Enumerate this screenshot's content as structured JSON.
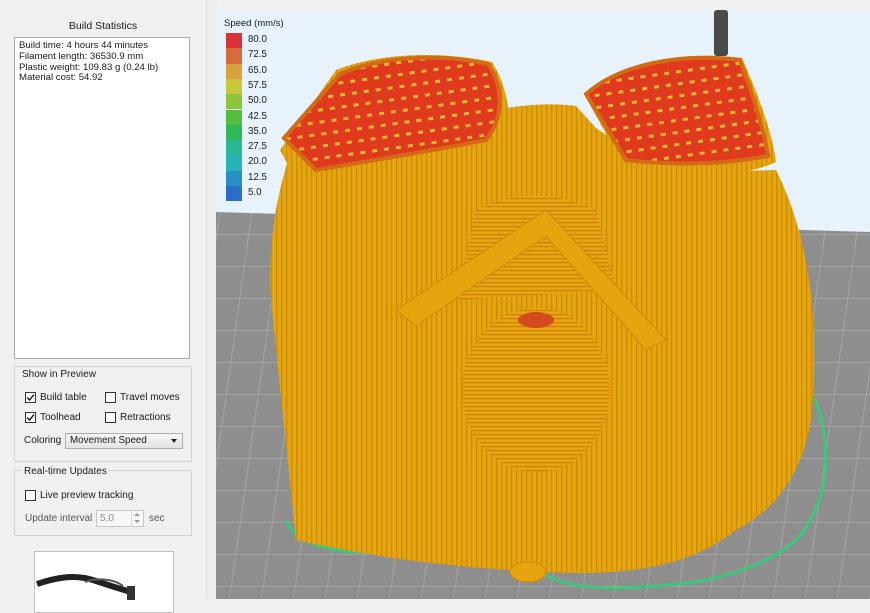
{
  "build_statistics": {
    "title": "Build Statistics",
    "lines": [
      "Build time: 4 hours 44 minutes",
      "Filament length: 36530.9 mm",
      "Plastic weight: 109.83 g (0.24 lb)",
      "Material cost: 54.92"
    ]
  },
  "show_in_preview": {
    "title": "Show in Preview",
    "build_table": {
      "label": "Build table",
      "checked": true
    },
    "travel_moves": {
      "label": "Travel moves",
      "checked": false
    },
    "toolhead": {
      "label": "Toolhead",
      "checked": true
    },
    "retractions": {
      "label": "Retractions",
      "checked": false
    },
    "coloring_label": "Coloring",
    "coloring_value": "Movement Speed"
  },
  "realtime_updates": {
    "title": "Real-time Updates",
    "live_preview": {
      "label": "Live preview tracking",
      "checked": false
    },
    "interval_label": "Update interval",
    "interval_value": "5,0",
    "interval_unit": "sec"
  },
  "legend": {
    "title": "Speed (mm/s)",
    "entries": [
      {
        "value": "80.0",
        "color": "#d8323a"
      },
      {
        "value": "72.5",
        "color": "#d96a3c"
      },
      {
        "value": "65.0",
        "color": "#d9a23c"
      },
      {
        "value": "57.5",
        "color": "#c8c83c"
      },
      {
        "value": "50.0",
        "color": "#8ec43c"
      },
      {
        "value": "42.5",
        "color": "#52bd3e"
      },
      {
        "value": "35.0",
        "color": "#2fb856"
      },
      {
        "value": "27.5",
        "color": "#2bb896"
      },
      {
        "value": "20.0",
        "color": "#28b4b6"
      },
      {
        "value": "12.5",
        "color": "#2890c2"
      },
      {
        "value": "5.0",
        "color": "#2d6cc8"
      }
    ]
  },
  "colors": {
    "print_body": "#e9a80d",
    "print_top": "#e03a1e",
    "skirt": "#3cc87a",
    "build_plate": "#8e8e8e",
    "background": "#e7f2fb"
  }
}
